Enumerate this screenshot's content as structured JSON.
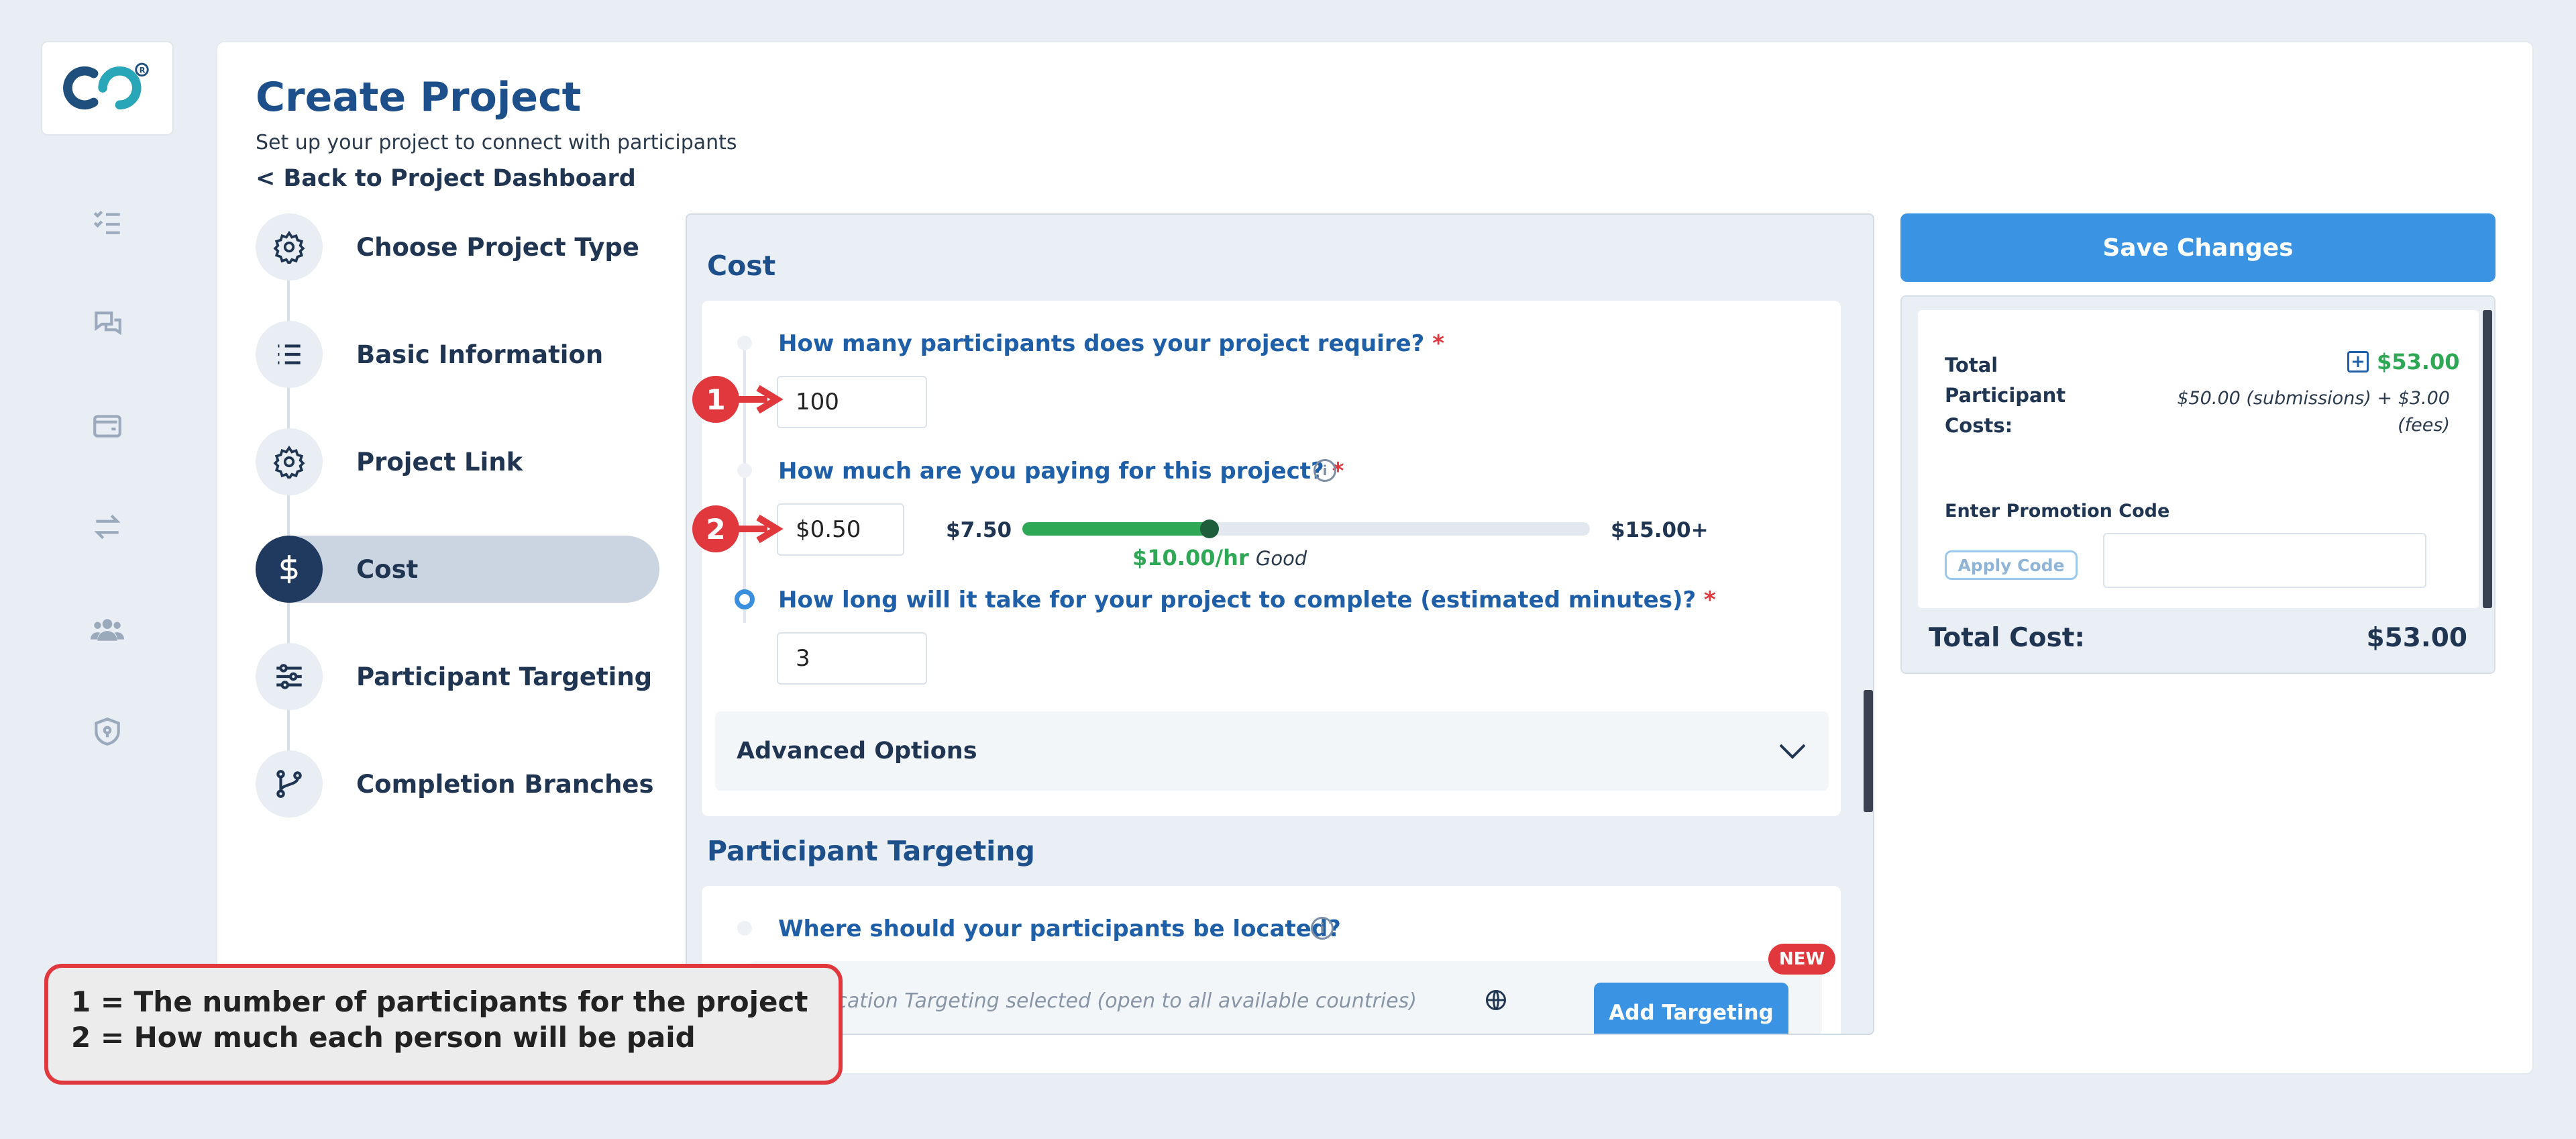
{
  "app": {
    "logo": "CO logo"
  },
  "sidebar_nav": [
    {
      "icon": "checklist-icon"
    },
    {
      "icon": "chat-icon"
    },
    {
      "icon": "wallet-icon"
    },
    {
      "icon": "transfer-icon"
    },
    {
      "icon": "users-icon"
    },
    {
      "icon": "shield-icon"
    }
  ],
  "header": {
    "title": "Create Project",
    "subtitle": "Set up your project to connect with participants",
    "back_link": "Back to Project Dashboard"
  },
  "steps": [
    {
      "label": "Choose Project Type",
      "icon": "gear-icon",
      "active": false
    },
    {
      "label": "Basic Information",
      "icon": "list-icon",
      "active": false
    },
    {
      "label": "Project Link",
      "icon": "gear-icon",
      "active": false
    },
    {
      "label": "Cost",
      "icon": "dollar-icon",
      "active": true
    },
    {
      "label": "Participant Targeting",
      "icon": "sliders-icon",
      "active": false
    },
    {
      "label": "Completion Branches",
      "icon": "branch-icon",
      "active": false
    }
  ],
  "cost": {
    "section_title": "Cost",
    "q_participants": "How many participants does your project require?",
    "participants_value": "100",
    "q_payment": "How much are you paying for this project?",
    "payment_value": "$0.50",
    "slider_min": "$7.50",
    "slider_max": "$15.00+",
    "slider_fill_fraction": 0.33,
    "rate_value": "$10.00/hr",
    "rate_label": "Good",
    "q_duration": "How long will it take for your project to complete (estimated minutes)?",
    "duration_value": "3",
    "required_mark": "*",
    "advanced_options": "Advanced Options"
  },
  "targeting": {
    "section_title": "Participant Targeting",
    "q_location": "Where should your participants be located?",
    "location_text": "No Location Targeting selected (open to all available countries)",
    "new_badge": "NEW",
    "add_targeting": "Add Targeting"
  },
  "summary": {
    "save_button": "Save Changes",
    "total_participant_costs_label": "Total Participant Costs:",
    "total_participant_costs_value": "$53.00",
    "breakdown": "$50.00 (submissions) + $3.00 (fees)",
    "promo_label": "Enter Promotion Code",
    "apply_code": "Apply Code",
    "promo_placeholder": "",
    "total_cost_label": "Total Cost:",
    "total_cost_value": "$53.00"
  },
  "annotations": {
    "badge_1": "1",
    "badge_2": "2",
    "callout_line_1": "1 = The number of participants for the project",
    "callout_line_2": "2 = How much each person will be paid"
  },
  "colors": {
    "primary": "#3b93e4",
    "title_blue": "#1d4f8a",
    "question_blue": "#1f5fa8",
    "required_red": "#e0383d",
    "success_green": "#2fa855",
    "callout_red": "#e0383d"
  }
}
